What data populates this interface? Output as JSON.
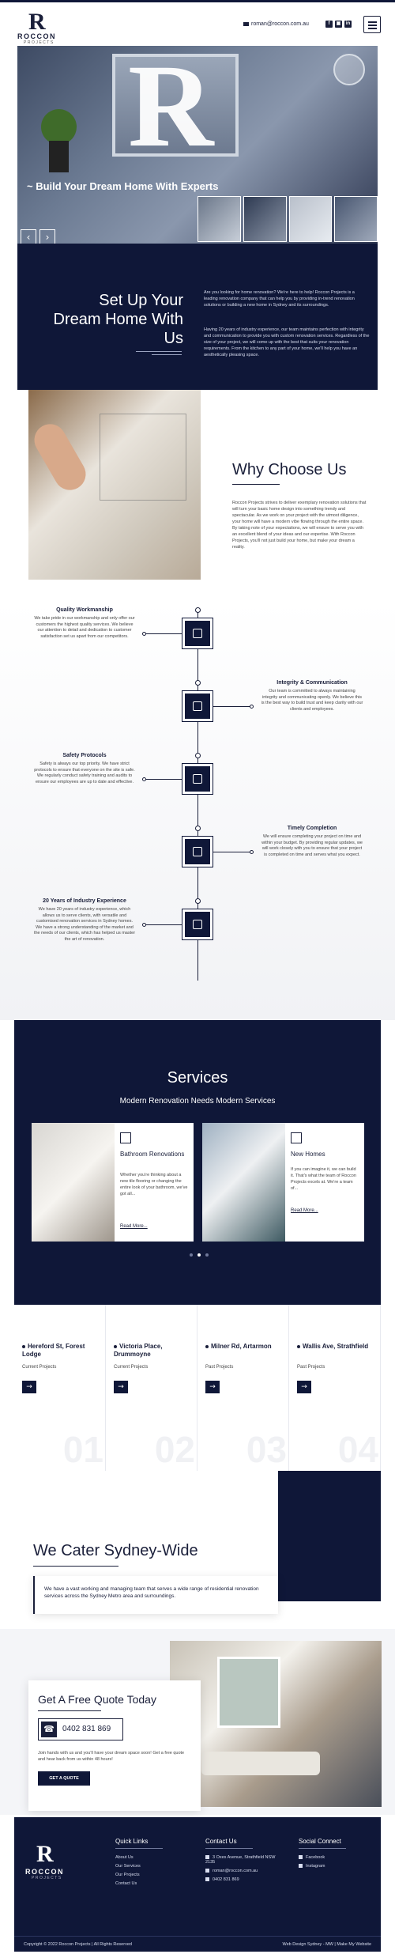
{
  "header": {
    "logo_letter": "R",
    "logo_name": "ROCCON",
    "logo_sub": "PROJECTS",
    "email": "roman@roccon.com.au",
    "social": [
      "f",
      "▣",
      "in"
    ]
  },
  "hero": {
    "tagline": "~ Build Your Dream Home With Experts",
    "prev": "‹",
    "next": "›"
  },
  "intro": {
    "title": "Set Up Your Dream Home With Us",
    "p1": "Are you looking for home renovation? We're here to help! Roccon Projects is a leading renovation company that can help you by providing in-trend renovation solutions or building a new home in Sydney and its surroundings.",
    "p2": "Having 20 years of industry experience, our team maintains perfection with integrity and communication to provide you with custom renovation services. Regardless of the size of your project, we will come up with the best that suits your renovation requirements. From the kitchen to any part of your home, we'll help you have an aesthetically pleasing space."
  },
  "why": {
    "title": "Why Choose Us",
    "text": "Roccon Projects strives to deliver exemplary renovation solutions that will turn your basic home design into something trendy and spectacular. As we work on your project with the utmost diligence, your home will have a modern vibe flowing through the entire space. By taking note of your expectations, we will ensure to serve you with an excellent blend of your ideas and our expertise. With Roccon Projects, you'll not just build your home, but make your dream a reality."
  },
  "timeline": [
    {
      "title": "Quality Workmanship",
      "text": "We take pride in our workmanship and only offer our customers the highest quality services. We believe our attention to detail and dedication to customer satisfaction set us apart from our competitors."
    },
    {
      "title": "Integrity & Communication",
      "text": "Our team is committed to always maintaining integrity and communicating openly. We believe this is the best way to build trust and keep clarity with our clients and employees."
    },
    {
      "title": "Safety Protocols",
      "text": "Safety is always our top priority. We have strict protocols to ensure that everyone on the site is safe. We regularly conduct safety training and audits to ensure our employees are up to date and effective."
    },
    {
      "title": "Timely Completion",
      "text": "We will ensure completing your project on time and within your budget. By providing regular updates, we will work closely with you to ensure that your project is completed on time and serves what you expect."
    },
    {
      "title": "20 Years of Industry Experience",
      "text": "We have 20 years of industry experience, which allows us to serve clients, with versatile and customised renovation services in Sydney homes. We have a strong understanding of the market and the needs of our clients, which has helped us master the art of renovation."
    }
  ],
  "services": {
    "title": "Services",
    "subtitle": "Modern Renovation Needs Modern Services",
    "cards": [
      {
        "title": "Bathroom Renovations",
        "text": "Whether you're thinking about a new tile flooring or changing the entire look of your bathroom, we've got all...",
        "link": "Read More..."
      },
      {
        "title": "New Homes",
        "text": "If you can imagine it, we can build it. That's what the team of Roccon Projects excels at. We're a team of...",
        "link": "Read More..."
      }
    ]
  },
  "projects": [
    {
      "title": "Hereford St, Forest Lodge",
      "status": "Current Projects",
      "num": "01"
    },
    {
      "title": "Victoria Place, Drummoyne",
      "status": "Current Projects",
      "num": "02"
    },
    {
      "title": "Milner Rd, Artarmon",
      "status": "Past Projects",
      "num": "03"
    },
    {
      "title": "Wallis Ave, Strathfield",
      "status": "Past Projects",
      "num": "04"
    }
  ],
  "cater": {
    "title": "We Cater Sydney-Wide",
    "text": "We have a vast working and managing team that serves a wide range of residential renovation services across the Sydney Metro area and surroundings."
  },
  "quote": {
    "title": "Get A Free Quote Today",
    "phone": "0402 831 869",
    "text": "Join hands with us and you'll have your dream space soon! Get a free quote and hear back from us within 48 hours!",
    "cta": "GET A QUOTE"
  },
  "footer": {
    "quick_title": "Quick Links",
    "quick": [
      "About Us",
      "Our Services",
      "Our Projects",
      "Contact Us"
    ],
    "contact_title": "Contact Us",
    "address": "3 Oxes Avenue, Strathfield NSW 2135",
    "email": "roman@roccon.com.au",
    "phone": "0402 831 869",
    "social_title": "Social Connect",
    "social": [
      "Facebook",
      "Instagram"
    ],
    "copyright": "Copyright © 2022 Roccon Projects | All Rights Reserved",
    "credit": "Web Design Sydney - MW | Make My Website"
  }
}
